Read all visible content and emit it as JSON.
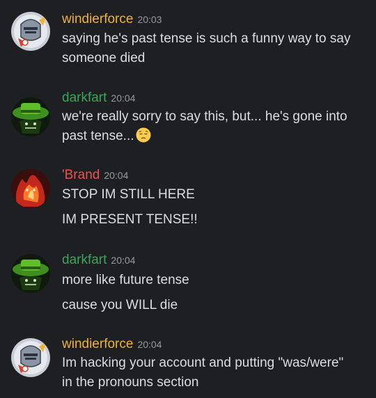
{
  "colors": {
    "background": "#1e1f22",
    "username_yellow": "#f0b232",
    "username_green": "#3ba55c",
    "username_red": "#e8544b",
    "timestamp": "#949ba4",
    "text": "#dbdee1"
  },
  "messages": [
    {
      "author": "windierforce",
      "time": "20:03",
      "avatar_icon": "knight-helmet-avatar",
      "lines": [
        "saying he's past tense is such a funny way to say",
        "someone died"
      ]
    },
    {
      "author": "darkfart",
      "time": "20:04",
      "avatar_icon": "green-hat-avatar",
      "lines": [
        "we're really sorry to say this, but... he's gone into",
        "past tense..."
      ],
      "emoji": "pensive-face-emoji"
    },
    {
      "author": "'Brand",
      "time": "20:04",
      "avatar_icon": "red-fire-character-avatar",
      "lines": [
        "STOP IM STILL HERE",
        "IM PRESENT TENSE!!"
      ]
    },
    {
      "author": "darkfart",
      "time": "20:04",
      "avatar_icon": "green-hat-avatar",
      "lines": [
        "more like future tense",
        "cause you WILL die"
      ]
    },
    {
      "author": "windierforce",
      "time": "20:04",
      "avatar_icon": "knight-helmet-avatar",
      "lines": [
        "Im hacking your account and putting \"was/were\"",
        "in the pronouns section"
      ]
    }
  ]
}
